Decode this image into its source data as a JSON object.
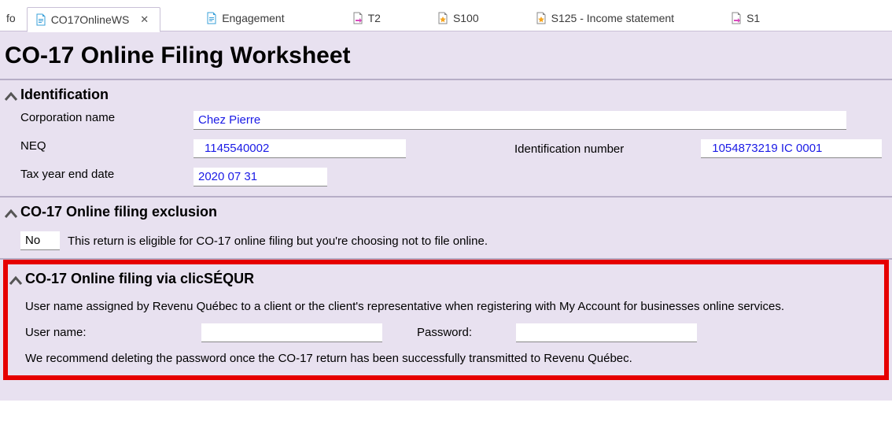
{
  "tabs": {
    "partial_left": "fo",
    "items": [
      {
        "label": "CO17OnlineWS",
        "icon": "blue",
        "active": true
      },
      {
        "label": "Engagement",
        "icon": "blue",
        "active": false
      },
      {
        "label": "T2",
        "icon": "pink",
        "active": false
      },
      {
        "label": "S100",
        "icon": "orange",
        "active": false
      },
      {
        "label": "S125 - Income statement",
        "icon": "orange",
        "active": false
      },
      {
        "label": "S1",
        "icon": "pink",
        "active": false
      }
    ]
  },
  "page_title": "CO-17 Online Filing Worksheet",
  "colors": {
    "page_bg": "#e8e1f0",
    "rule": "#b7aec7",
    "highlight_border": "#e60000",
    "value_color": "#1a1ae6"
  },
  "identification": {
    "heading": "Identification",
    "corp_name_label": "Corporation name",
    "corp_name": "Chez Pierre",
    "neq_label": "NEQ",
    "neq": "1145540002",
    "id_number_label": "Identification number",
    "id_number": "1054873219 IC 0001",
    "tax_year_end_label": "Tax year end date",
    "tax_year_end": "2020 07 31"
  },
  "exclusion": {
    "heading": "CO-17 Online filing exclusion",
    "value": "No",
    "text": "This return is eligible for CO-17 online filing but you're choosing not to file online."
  },
  "clicsequr": {
    "heading": "CO-17 Online filing via clicSÉQUR",
    "intro": "User name assigned by Revenu Québec to a client or the client's representative when registering with My Account for businesses online services.",
    "user_label": "User name:",
    "user_value": "",
    "pass_label": "Password:",
    "pass_value": "",
    "note": "We recommend deleting the password once the CO-17 return has been successfully transmitted to Revenu Québec."
  }
}
